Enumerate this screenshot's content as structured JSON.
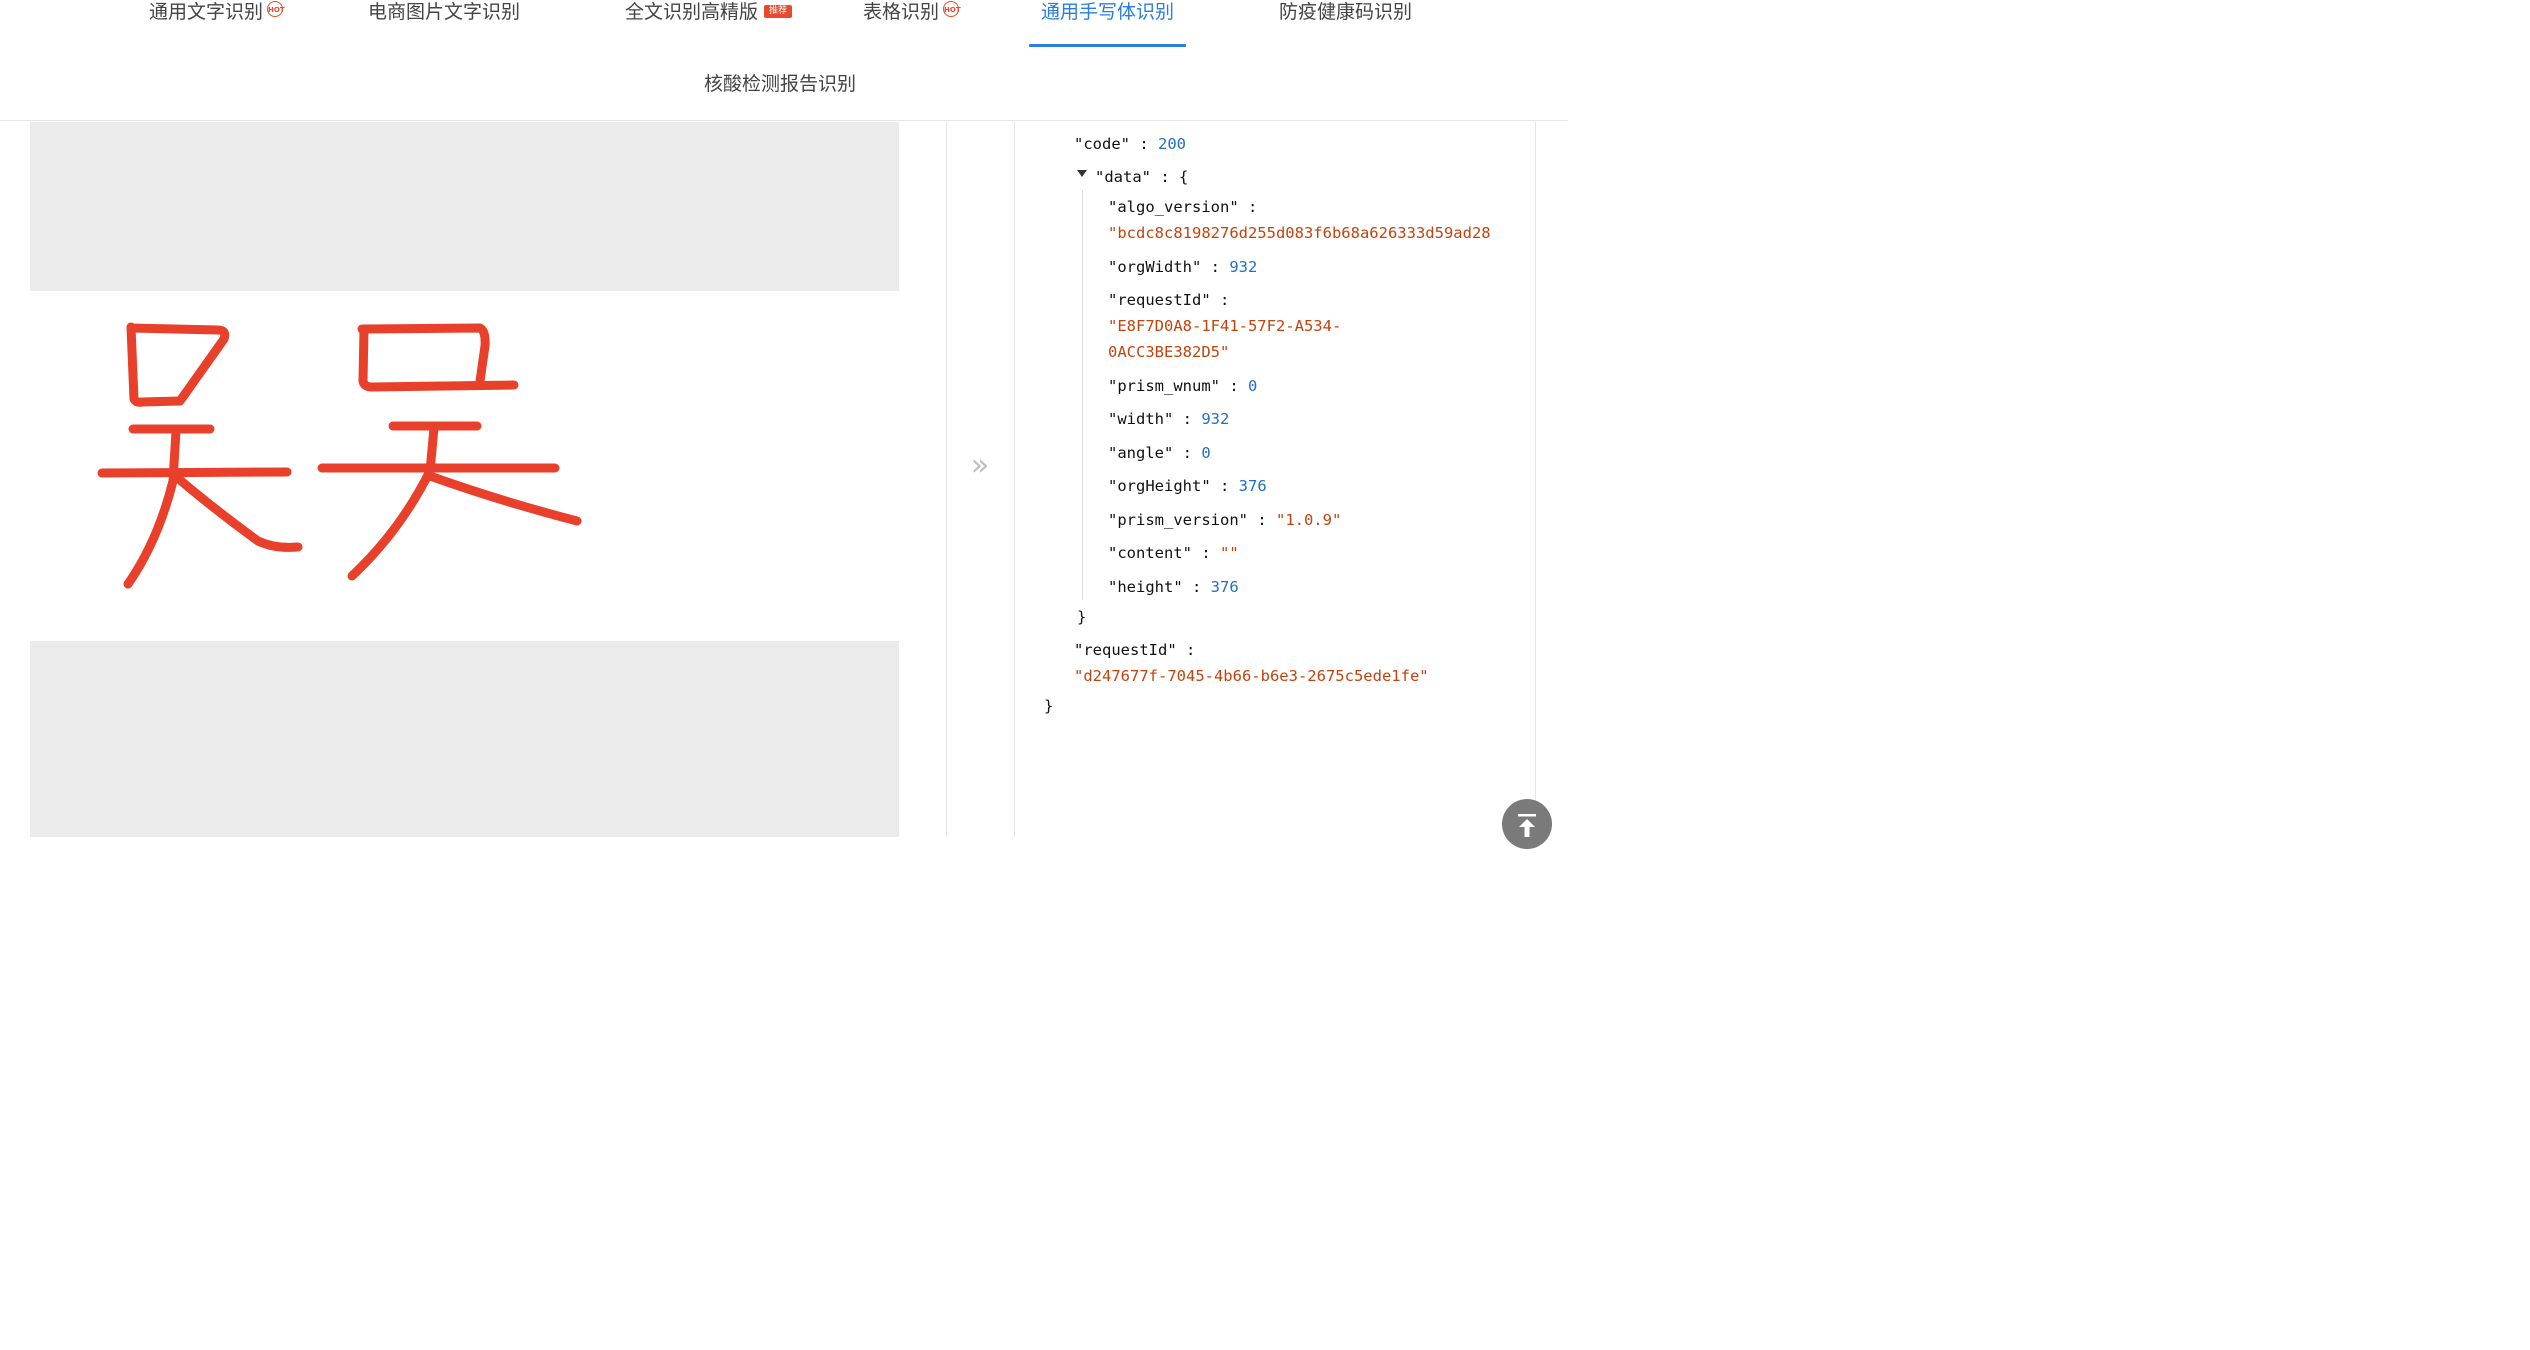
{
  "tabs": [
    {
      "label": "通用文字识别",
      "badge": "HOT",
      "active": false
    },
    {
      "label": "电商图片文字识别",
      "badge": "",
      "active": false
    },
    {
      "label": "全文识别高精版",
      "badge": "推荐",
      "active": false
    },
    {
      "label": "表格识别",
      "badge": "HOT",
      "active": false
    },
    {
      "label": "通用手写体识别",
      "badge": "",
      "active": true
    },
    {
      "label": "防疫健康码识别",
      "badge": "",
      "active": false
    },
    {
      "label": "核酸检测报告识别",
      "badge": "",
      "active": false
    }
  ],
  "image": {
    "handwritten_text": "吴吴",
    "stroke_color": "#e8402a"
  },
  "json_result": {
    "code_key": "\"code\"",
    "code_value": "200",
    "data_key": "\"data\"",
    "fields": [
      {
        "key": "\"algo_version\"",
        "value": "\"bcdc8c8198276d255d083f6b68a626333d59ad28",
        "type": "string"
      },
      {
        "key": "\"orgWidth\"",
        "value": "932",
        "type": "number"
      },
      {
        "key": "\"requestId\"",
        "value_line1": "\"E8F7D0A8-1F41-57F2-A534-",
        "value_line2": "0ACC3BE382D5\"",
        "type": "string"
      },
      {
        "key": "\"prism_wnum\"",
        "value": "0",
        "type": "number"
      },
      {
        "key": "\"width\"",
        "value": "932",
        "type": "number"
      },
      {
        "key": "\"angle\"",
        "value": "0",
        "type": "number"
      },
      {
        "key": "\"orgHeight\"",
        "value": "376",
        "type": "number"
      },
      {
        "key": "\"prism_version\"",
        "value": "\"1.0.9\"",
        "type": "string"
      },
      {
        "key": "\"content\"",
        "value": "\"\"",
        "type": "string"
      },
      {
        "key": "\"height\"",
        "value": "376",
        "type": "number"
      }
    ],
    "request_id_key": "\"requestId\"",
    "request_id_value": "\"d247677f-7045-4b66-b6e3-2675c5ede1fe\""
  },
  "icons": {
    "expand_arrow": "double-chevron-right-icon",
    "back_to_top": "arrow-up-icon"
  },
  "colors": {
    "accent": "#2a7de1",
    "badge": "#e84a2d",
    "json_number": "#1f6fc5",
    "json_string": "#c1440e"
  }
}
